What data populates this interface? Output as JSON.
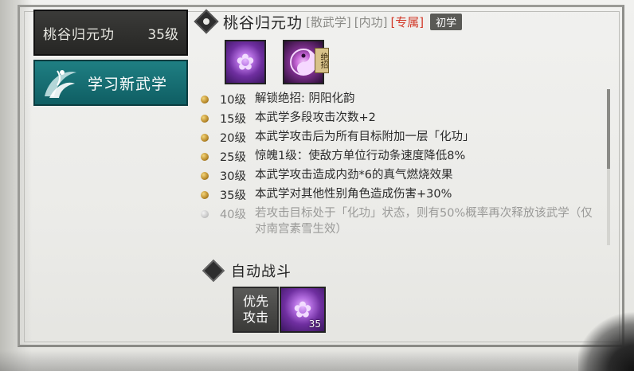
{
  "sidebar": {
    "active_skill": {
      "name": "桃谷归元功",
      "level": "35级"
    },
    "learn_button": "学习新武学"
  },
  "skill": {
    "title": "桃谷归元功",
    "tags": [
      "[散武学]",
      "[内功]",
      "[专属]"
    ],
    "badge": "初学",
    "ult_label": "绝招"
  },
  "levels": [
    {
      "lvl": "10级",
      "text": "解锁绝招:  阴阳化韵",
      "unlocked": true
    },
    {
      "lvl": "15级",
      "text": "本武学多段攻击次数+2",
      "unlocked": true
    },
    {
      "lvl": "20级",
      "text": "本武学攻击后为所有目标附加一层「化功」",
      "unlocked": true
    },
    {
      "lvl": "25级",
      "text": "惊魄1级：使敌方单位行动条速度降低8%",
      "unlocked": true
    },
    {
      "lvl": "30级",
      "text": "本武学攻击造成内劲*6的真气燃烧效果",
      "unlocked": true
    },
    {
      "lvl": "35级",
      "text": "本武学对其他性别角色造成伤害+30%",
      "unlocked": true
    },
    {
      "lvl": "40级",
      "text": "若攻击目标处于「化功」状态，则有50%概率再次释放该武学（仅对南宫素雪生效）",
      "unlocked": false
    }
  ],
  "auto_battle": {
    "title": "自动战斗",
    "priority_label_1": "优先",
    "priority_label_2": "攻击",
    "slot_level": "35"
  }
}
